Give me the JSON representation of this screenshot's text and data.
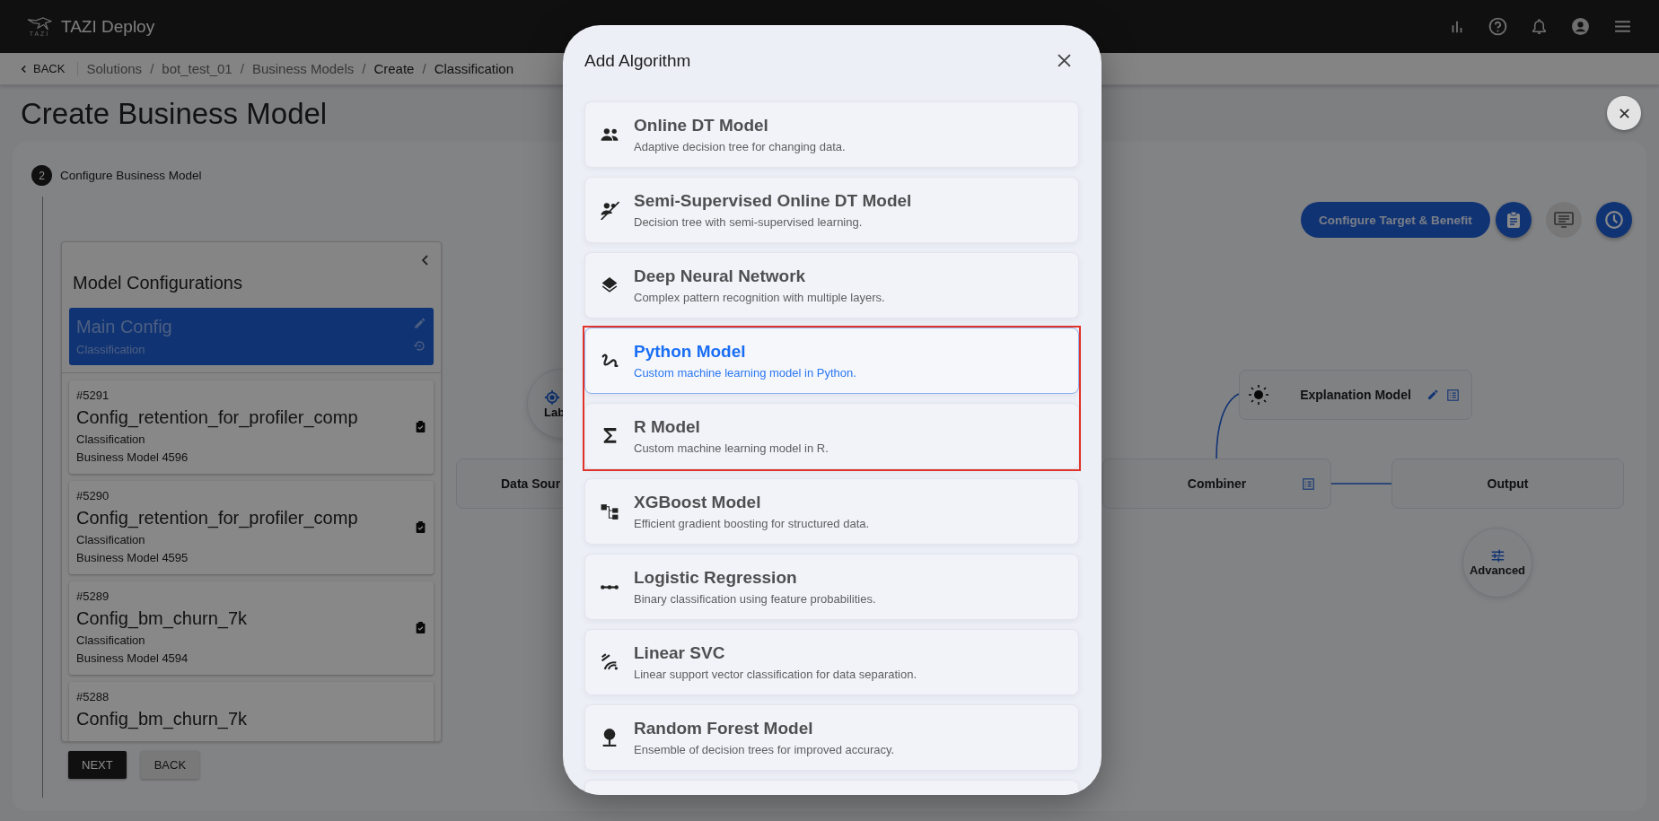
{
  "app_bar": {
    "logo_caption": "TAZI",
    "title": "TAZI Deploy"
  },
  "breadcrumb": {
    "back": "BACK",
    "separator": "/",
    "items": [
      {
        "label": "Solutions",
        "link": true
      },
      {
        "label": "bot_test_01",
        "link": true
      },
      {
        "label": "Business Models",
        "link": true
      },
      {
        "label": "Create",
        "link": false
      },
      {
        "label": "Classification",
        "link": false
      }
    ]
  },
  "page": {
    "title": "Create Business Model"
  },
  "step": {
    "number": "2",
    "label": "Configure Business Model"
  },
  "model_configurations": {
    "title": "Model Configurations",
    "main": {
      "name": "Main Config",
      "type": "Classification",
      "selected": true
    },
    "configs": [
      {
        "id": "#5291",
        "name": "Config_retention_for_profiler_comp",
        "type": "Classification",
        "business_model": "Business Model 4596"
      },
      {
        "id": "#5290",
        "name": "Config_retention_for_profiler_comp",
        "type": "Classification",
        "business_model": "Business Model 4595"
      },
      {
        "id": "#5289",
        "name": "Config_bm_churn_7k",
        "type": "Classification",
        "business_model": "Business Model 4594"
      },
      {
        "id": "#5288",
        "name": "Config_bm_churn_7k"
      }
    ]
  },
  "buttons": [
    {
      "label": "NEXT",
      "kind": "primary"
    },
    {
      "label": "BACK",
      "kind": "secondary"
    }
  ],
  "toolbar": {
    "configure_button": "Configure Target & Benefit",
    "icon_buttons": [
      {
        "kind": "clipboard",
        "disabled": false
      },
      {
        "kind": "monitor",
        "disabled": true
      },
      {
        "kind": "clock",
        "disabled": false
      }
    ]
  },
  "flow": {
    "nodes": [
      {
        "kind": "circle",
        "label": "Lab"
      },
      {
        "kind": "box",
        "label": "Data Sour"
      },
      {
        "kind": "box",
        "label": "Explanation Model"
      },
      {
        "kind": "box",
        "label": "Combiner"
      },
      {
        "kind": "box",
        "label": "Output"
      },
      {
        "kind": "circle",
        "label": "Advanced"
      }
    ]
  },
  "dialog": {
    "title": "Add Algorithm",
    "algorithms": [
      {
        "kind": "people",
        "name": "Online DT Model",
        "description": "Adaptive decision tree for changing data.",
        "selected": false,
        "highlighted": false
      },
      {
        "kind": "people-off",
        "name": "Semi-Supervised Online DT Model",
        "description": "Decision tree with semi-supervised learning.",
        "selected": false,
        "highlighted": false
      },
      {
        "kind": "layers",
        "name": "Deep Neural Network",
        "description": "Complex pattern recognition with multiple layers.",
        "selected": false,
        "highlighted": false
      },
      {
        "kind": "squiggle",
        "name": "Python Model",
        "description": "Custom machine learning model in Python.",
        "selected": true,
        "highlighted": true
      },
      {
        "kind": "sigma",
        "name": "R Model",
        "description": "Custom machine learning model in R.",
        "selected": false,
        "highlighted": true
      },
      {
        "kind": "tree",
        "name": "XGBoost Model",
        "description": "Efficient gradient boosting for structured data.",
        "selected": false,
        "highlighted": false
      },
      {
        "kind": "dots",
        "name": "Logistic Regression",
        "description": "Binary classification using feature probabilities.",
        "selected": false,
        "highlighted": false
      },
      {
        "kind": "waves",
        "name": "Linear SVC",
        "description": "Linear support vector classification for data separation.",
        "selected": false,
        "highlighted": false
      },
      {
        "kind": "pin",
        "name": "Random Forest Model",
        "description": "Ensemble of decision trees for improved accuracy.",
        "selected": false,
        "highlighted": false
      },
      {
        "kind": "partial"
      }
    ]
  }
}
